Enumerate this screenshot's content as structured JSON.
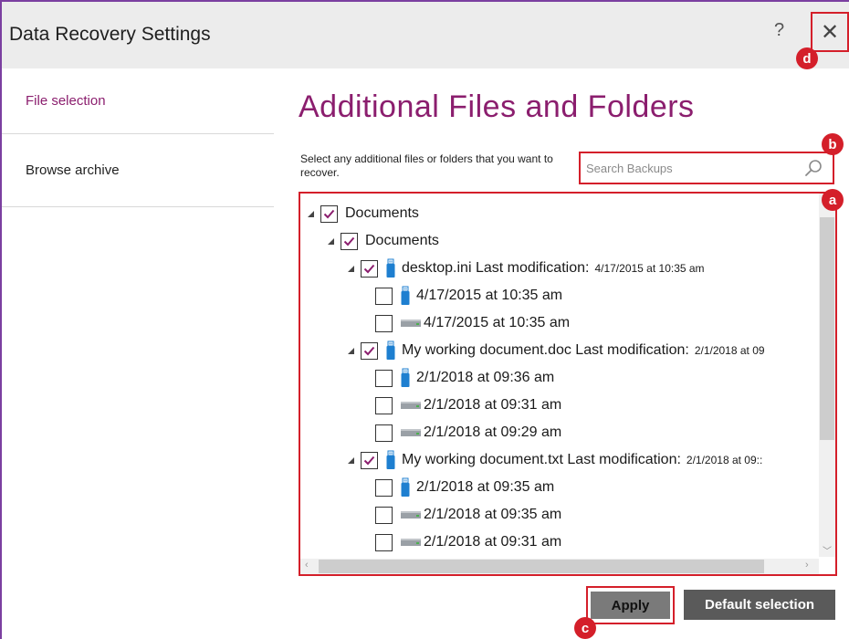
{
  "window": {
    "title": "Data Recovery Settings",
    "help_label": "?",
    "close_label": "✕"
  },
  "sidebar": {
    "items": [
      {
        "label": "File selection"
      },
      {
        "label": "Browse archive"
      }
    ]
  },
  "main": {
    "heading": "Additional Files and Folders",
    "instructions": "Select any additional files or folders that you want to recover.",
    "search": {
      "placeholder": "Search Backups",
      "value": ""
    }
  },
  "tree": [
    {
      "level": 0,
      "expanded": true,
      "checked": true,
      "icon": "none",
      "label": "Documents",
      "meta": ""
    },
    {
      "level": 1,
      "expanded": true,
      "checked": true,
      "icon": "none",
      "label": "Documents",
      "meta": ""
    },
    {
      "level": 2,
      "expanded": true,
      "checked": true,
      "icon": "usb-drive-icon",
      "label": "desktop.ini Last modification:",
      "meta": "4/17/2015 at 10:35 am"
    },
    {
      "level": 3,
      "expanded": null,
      "checked": false,
      "icon": "usb-drive-icon",
      "label": "4/17/2015 at 10:35 am",
      "meta": ""
    },
    {
      "level": 3,
      "expanded": null,
      "checked": false,
      "icon": "hard-drive-icon",
      "label": "4/17/2015 at 10:35 am",
      "meta": ""
    },
    {
      "level": 2,
      "expanded": true,
      "checked": true,
      "icon": "usb-drive-icon",
      "label": "My working document.doc Last modification:",
      "meta": "2/1/2018 at 09"
    },
    {
      "level": 3,
      "expanded": null,
      "checked": false,
      "icon": "usb-drive-icon",
      "label": "2/1/2018 at 09:36 am",
      "meta": ""
    },
    {
      "level": 3,
      "expanded": null,
      "checked": false,
      "icon": "hard-drive-icon",
      "label": "2/1/2018 at 09:31 am",
      "meta": ""
    },
    {
      "level": 3,
      "expanded": null,
      "checked": false,
      "icon": "hard-drive-icon",
      "label": "2/1/2018 at 09:29 am",
      "meta": ""
    },
    {
      "level": 2,
      "expanded": true,
      "checked": true,
      "icon": "usb-drive-icon",
      "label": "My working document.txt Last modification:",
      "meta": "2/1/2018 at 09::"
    },
    {
      "level": 3,
      "expanded": null,
      "checked": false,
      "icon": "usb-drive-icon",
      "label": "2/1/2018 at 09:35 am",
      "meta": ""
    },
    {
      "level": 3,
      "expanded": null,
      "checked": false,
      "icon": "hard-drive-icon",
      "label": "2/1/2018 at 09:35 am",
      "meta": ""
    },
    {
      "level": 3,
      "expanded": null,
      "checked": false,
      "icon": "hard-drive-icon",
      "label": "2/1/2018 at 09:31 am",
      "meta": ""
    }
  ],
  "buttons": {
    "apply": "Apply",
    "default_selection": "Default selection"
  },
  "annotations": {
    "a": "a",
    "b": "b",
    "c": "c",
    "d": "d"
  },
  "colors": {
    "accent": "#8b1e6e",
    "highlight": "#d41f2a",
    "usb": "#1e7fd0",
    "drive": "#9aa0a6"
  }
}
